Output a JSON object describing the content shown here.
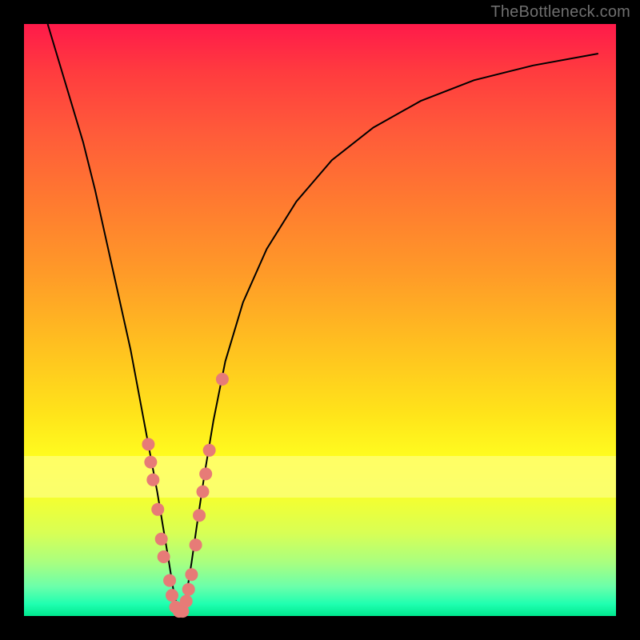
{
  "watermark": "TheBottleneck.com",
  "chart_data": {
    "type": "line",
    "title": "",
    "xlabel": "",
    "ylabel": "",
    "xlim": [
      0,
      100
    ],
    "ylim": [
      0,
      100
    ],
    "grid": false,
    "legend": false,
    "series": [
      {
        "name": "bottleneck-curve",
        "x": [
          4,
          7,
          10,
          12,
          14,
          16,
          18,
          19.5,
          21,
          22.5,
          23.5,
          24.5,
          25.3,
          26,
          26.7,
          27.5,
          28.3,
          29.3,
          30.5,
          32,
          34,
          37,
          41,
          46,
          52,
          59,
          67,
          76,
          86,
          97
        ],
        "y": [
          100,
          90,
          80,
          72,
          63,
          54,
          45,
          37,
          29,
          21,
          15,
          9,
          4,
          1,
          1,
          4,
          9,
          16,
          24,
          33,
          43,
          53,
          62,
          70,
          77,
          82.5,
          87,
          90.5,
          93,
          95
        ],
        "stroke": "#000000",
        "stroke_width": 2
      }
    ],
    "markers": {
      "name": "highlight-dots",
      "fill": "#e77b77",
      "radius": 8,
      "points": [
        {
          "x": 21.0,
          "y": 29
        },
        {
          "x": 21.4,
          "y": 26
        },
        {
          "x": 21.8,
          "y": 23
        },
        {
          "x": 22.6,
          "y": 18
        },
        {
          "x": 23.2,
          "y": 13
        },
        {
          "x": 23.6,
          "y": 10
        },
        {
          "x": 24.6,
          "y": 6
        },
        {
          "x": 25.0,
          "y": 3.5
        },
        {
          "x": 25.6,
          "y": 1.5
        },
        {
          "x": 26.2,
          "y": 0.8
        },
        {
          "x": 26.8,
          "y": 0.8
        },
        {
          "x": 27.4,
          "y": 2.5
        },
        {
          "x": 27.8,
          "y": 4.5
        },
        {
          "x": 28.3,
          "y": 7
        },
        {
          "x": 29.0,
          "y": 12
        },
        {
          "x": 29.6,
          "y": 17
        },
        {
          "x": 30.2,
          "y": 21
        },
        {
          "x": 30.7,
          "y": 24
        },
        {
          "x": 31.3,
          "y": 28
        },
        {
          "x": 33.5,
          "y": 40
        }
      ]
    },
    "bands": [
      {
        "name": "pale-yellow-band",
        "y_from": 73,
        "y_to": 80,
        "fill": "#ffff9e"
      }
    ],
    "background_gradient": {
      "direction": "vertical",
      "stops": [
        {
          "pct": 0,
          "color": "#ff1a4a"
        },
        {
          "pct": 18,
          "color": "#ff5a3a"
        },
        {
          "pct": 42,
          "color": "#ff9a28"
        },
        {
          "pct": 66,
          "color": "#ffe41a"
        },
        {
          "pct": 80,
          "color": "#f4ff30"
        },
        {
          "pct": 95,
          "color": "#6cffaa"
        },
        {
          "pct": 100,
          "color": "#00e88e"
        }
      ]
    }
  }
}
